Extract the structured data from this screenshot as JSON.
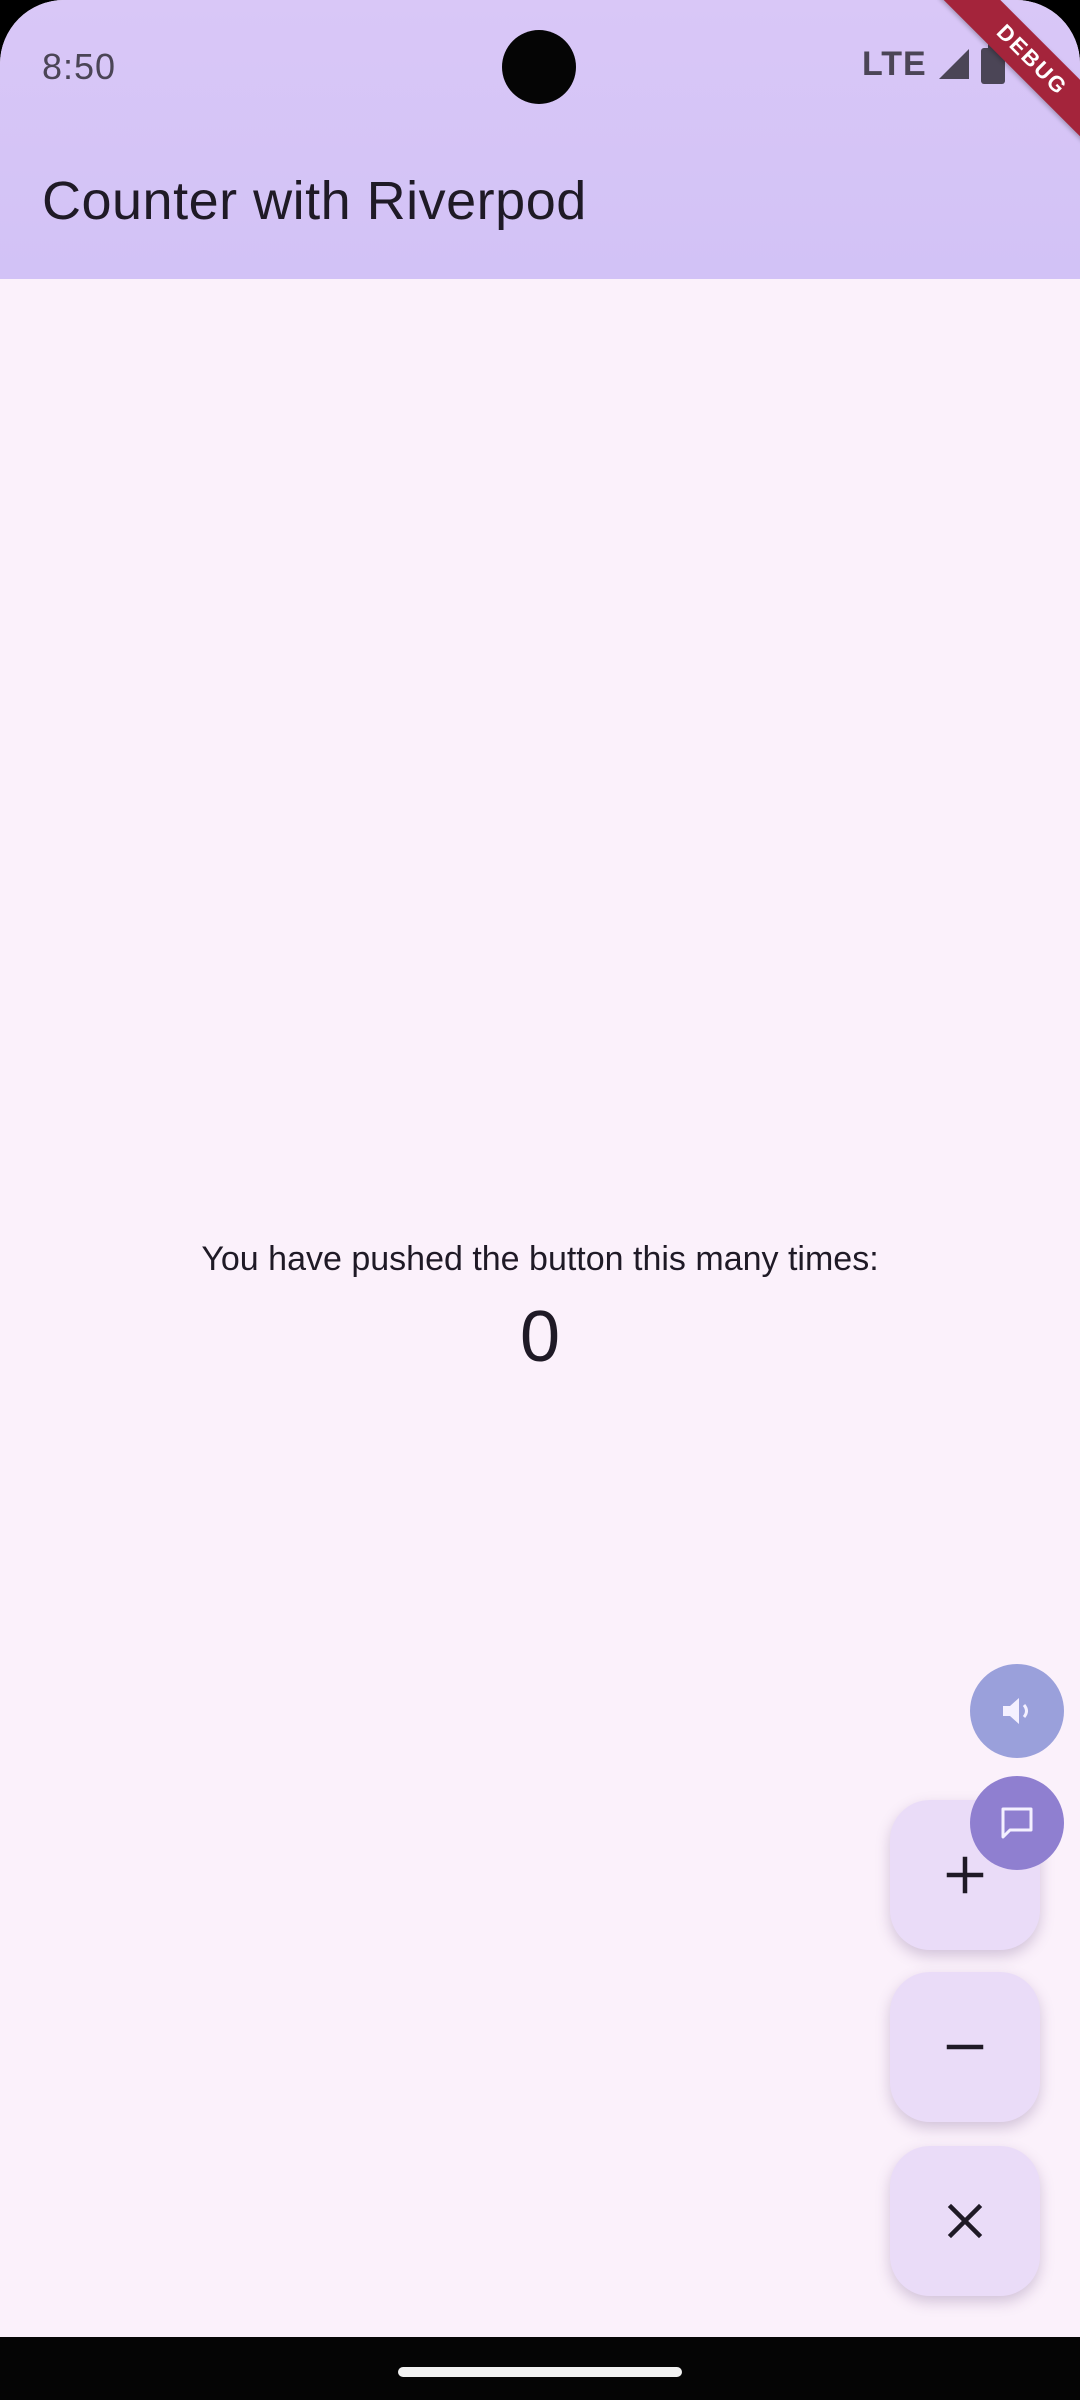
{
  "status_bar": {
    "time": "8:50",
    "network": "LTE",
    "signal_icon": "signal-icon",
    "battery_icon": "battery-icon"
  },
  "debug_banner": "DEBUG",
  "app_bar": {
    "title": "Counter with Riverpod"
  },
  "main": {
    "caption": "You have pushed the button this many times:",
    "counter": "0"
  },
  "fabs": [
    {
      "name": "increment-button",
      "icon": "plus-icon"
    },
    {
      "name": "decrement-button",
      "icon": "minus-icon"
    },
    {
      "name": "reset-button",
      "icon": "close-icon"
    }
  ],
  "overlay_bubbles": [
    {
      "name": "sound-bubble",
      "icon": "volume-icon"
    },
    {
      "name": "chat-bubble",
      "icon": "chat-icon"
    }
  ],
  "colors": {
    "app_bar": "#d9c7f7",
    "background": "#fbf1fb",
    "fab": "#eadcf8",
    "debug_banner": "#a4243b"
  }
}
